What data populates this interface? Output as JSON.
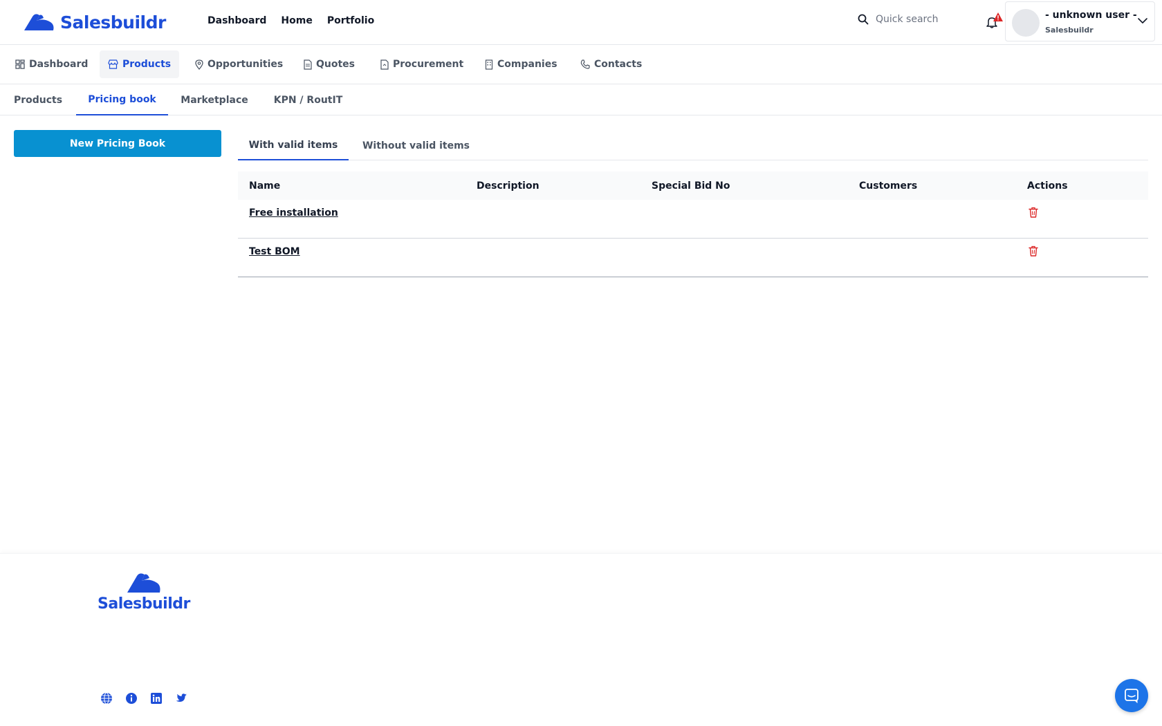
{
  "header": {
    "brand": "Salesbuildr",
    "nav": [
      {
        "label": "Dashboard"
      },
      {
        "label": "Home"
      },
      {
        "label": "Portfolio"
      }
    ],
    "search_placeholder": "Quick search",
    "user": {
      "name": "- unknown user -",
      "org": "Salesbuildr"
    }
  },
  "modules": [
    {
      "label": "Dashboard",
      "icon": "grid-icon"
    },
    {
      "label": "Products",
      "icon": "store-icon",
      "active": true
    },
    {
      "label": "Opportunities",
      "icon": "map-pin-icon"
    },
    {
      "label": "Quotes",
      "icon": "document-icon"
    },
    {
      "label": "Procurement",
      "icon": "document-icon"
    },
    {
      "label": "Companies",
      "icon": "building-icon"
    },
    {
      "label": "Contacts",
      "icon": "phone-icon"
    }
  ],
  "subtabs": [
    {
      "label": "Products"
    },
    {
      "label": "Pricing book",
      "active": true
    },
    {
      "label": "Marketplace"
    },
    {
      "label": "KPN / RoutIT"
    }
  ],
  "new_button": "New Pricing Book",
  "inner_tabs": [
    {
      "label": "With valid items",
      "active": true
    },
    {
      "label": "Without valid items"
    }
  ],
  "table": {
    "columns": [
      "Name",
      "Description",
      "Special Bid No",
      "Customers",
      "Actions"
    ],
    "rows": [
      {
        "name": "Free installation",
        "description": "",
        "special_bid_no": "",
        "customers": ""
      },
      {
        "name": "Test BOM",
        "description": "",
        "special_bid_no": "",
        "customers": ""
      }
    ]
  },
  "footer": {
    "brand": "Salesbuildr",
    "social": [
      "globe-icon",
      "info-icon",
      "linkedin-icon",
      "twitter-icon"
    ]
  },
  "colors": {
    "brand_blue": "#1d4ed8",
    "button_blue": "#0891d1",
    "danger_red": "#dc2626"
  }
}
